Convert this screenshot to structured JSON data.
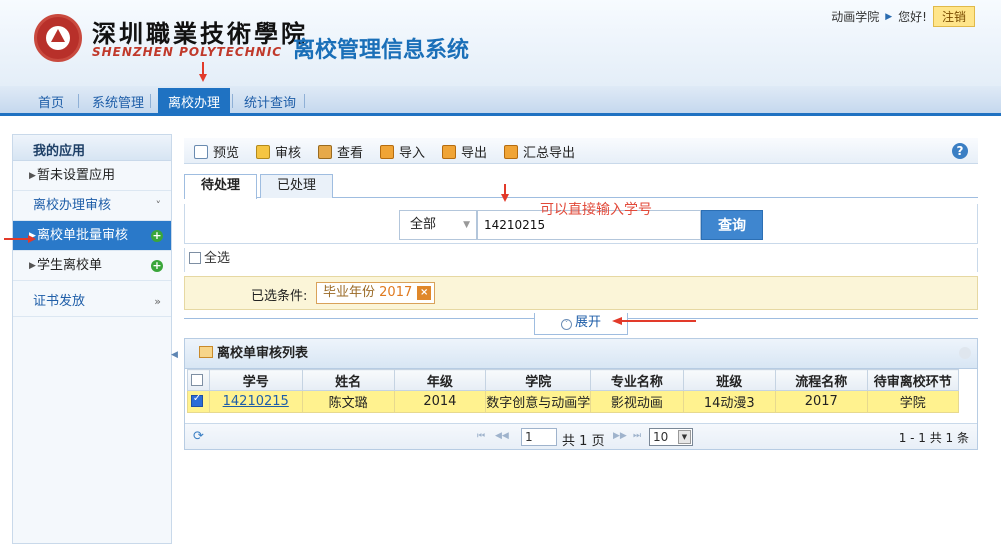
{
  "header": {
    "school_cn": "深圳職業技術學院",
    "school_en": "SHENZHEN POLYTECHNIC",
    "system_title": "离校管理信息系统",
    "user": "动画学院",
    "greeting": "您好!",
    "logout": "注销"
  },
  "nav": {
    "items": [
      "首页",
      "系统管理",
      "离校办理",
      "统计查询"
    ],
    "active": "离校办理"
  },
  "sidebar": {
    "my_apps": "我的应用",
    "no_app": "暂未设置应用",
    "group1": "离校办理审核",
    "item_batch": "离校单批量审核",
    "item_student": "学生离校单",
    "group2": "证书发放",
    "chev_down": "»",
    "chev_right": "»"
  },
  "toolbar": {
    "preview": "预览",
    "review": "审核",
    "view": "查看",
    "import": "导入",
    "export": "导出",
    "summary_export": "汇总导出",
    "help": "?"
  },
  "tabs": [
    "待处理",
    "已处理"
  ],
  "search": {
    "scope": "全部",
    "value": "14210215",
    "button": "查询",
    "note": "可以直接输入学号"
  },
  "select_all": "全选",
  "condition": {
    "label": "已选条件:",
    "chip_key": "毕业年份",
    "chip_value": "2017",
    "chip_remove": "×"
  },
  "expand": "展开",
  "grid": {
    "title": "离校单审核列表",
    "columns": [
      "学号",
      "姓名",
      "年级",
      "学院",
      "专业名称",
      "班级",
      "流程名称",
      "待审离校环节"
    ],
    "rows": [
      [
        "14210215",
        "陈文璐",
        "2014",
        "数字创意与动画学",
        "影视动画",
        "14动漫3",
        "2017",
        "学院"
      ]
    ]
  },
  "pager": {
    "page": "1",
    "total_prefix": "共",
    "total_pages": "1",
    "page_suffix": "页",
    "page_size": "10",
    "info": "1 - 1   共 1 条"
  },
  "colors": {
    "accent": "#1f72c2",
    "highlight_row": "#fff28f",
    "annotation": "#e23a2a"
  }
}
